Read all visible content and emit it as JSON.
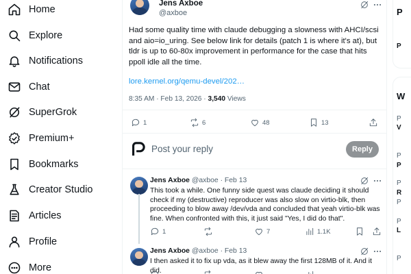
{
  "nav": {
    "items": [
      {
        "label": "Home",
        "icon": "home-icon"
      },
      {
        "label": "Explore",
        "icon": "search-icon"
      },
      {
        "label": "Notifications",
        "icon": "bell-icon"
      },
      {
        "label": "Chat",
        "icon": "mail-icon"
      },
      {
        "label": "SuperGrok",
        "icon": "grok-icon"
      },
      {
        "label": "Premium+",
        "icon": "verified-icon"
      },
      {
        "label": "Bookmarks",
        "icon": "bookmark-icon"
      },
      {
        "label": "Creator Studio",
        "icon": "flask-icon"
      },
      {
        "label": "Articles",
        "icon": "articles-icon"
      },
      {
        "label": "Profile",
        "icon": "person-icon"
      },
      {
        "label": "More",
        "icon": "more-icon"
      }
    ]
  },
  "post": {
    "author_name": "Jens Axboe",
    "author_handle": "@axboe",
    "text": "Had some quality time with claude debugging a slowness with AHCI/scsi and aio=io_uring. See below link for details (patch 1 is where it's at), but tldr is up to 60-80x improvement in performance for the case that hits ppoll idle all the time.",
    "link": "lore.kernel.org/qemu-devel/202…",
    "time": "8:35 AM · Feb 13, 2026 · ",
    "views_count": "3,540",
    "views_label": " Views",
    "replies": "1",
    "reposts": "6",
    "likes": "48",
    "bookmarks": "13"
  },
  "composer": {
    "placeholder": "Post your reply",
    "button_label": "Reply"
  },
  "replies": [
    {
      "name": "Jens Axboe",
      "handle": "@axboe · Feb 13",
      "text": "This took a while. One funny side quest was claude deciding it should check if my (destructive) reproducer was also slow on virtio-blk, then proceeding to blow away /dev/vda and concluded that yeah virtio-blk was fine. When confronted with this, it just said \"Yes, I did do that\".",
      "replies": "1",
      "reposts": "",
      "likes": "7",
      "views": "1.1K"
    },
    {
      "name": "Jens Axboe",
      "handle": "@axboe · Feb 13",
      "text": "I then asked it to fix up vda, as it blew away the first 128MB of it. And it did."
    }
  ],
  "sidebar_fragments": [
    "P",
    "P",
    "W",
    "P",
    "V",
    "P",
    "P",
    "P",
    "R",
    "P",
    "P",
    "L",
    "P"
  ]
}
